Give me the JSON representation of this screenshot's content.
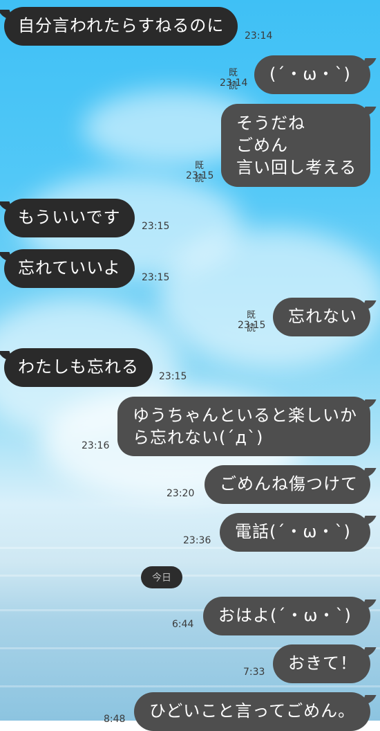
{
  "messages": [
    {
      "side": "in",
      "lines": [
        "自分言われたらすねるのに"
      ],
      "time": "23:14"
    },
    {
      "side": "out",
      "lines": [
        "(´・ω・`)"
      ],
      "time": "23:14",
      "read": "既読"
    },
    {
      "side": "out",
      "lines": [
        "そうだね",
        "ごめん",
        "言い回し考える"
      ],
      "time": "23:15",
      "read": "既読"
    },
    {
      "side": "in",
      "lines": [
        "もういいです"
      ],
      "time": "23:15"
    },
    {
      "side": "in",
      "lines": [
        "忘れていいよ"
      ],
      "time": "23:15"
    },
    {
      "side": "out",
      "lines": [
        "忘れない"
      ],
      "time": "23:15",
      "read": "既読"
    },
    {
      "side": "in",
      "lines": [
        "わたしも忘れる"
      ],
      "time": "23:15"
    },
    {
      "side": "out",
      "lines": [
        "ゆうちゃんといると楽しいか",
        "ら忘れない(´д`)"
      ],
      "time": "23:16"
    },
    {
      "side": "out",
      "lines": [
        "ごめんね傷つけて"
      ],
      "time": "23:20"
    },
    {
      "side": "out",
      "lines": [
        "電話(´・ω・`)"
      ],
      "time": "23:36"
    },
    {
      "side": "out",
      "lines": [
        "おはよ(´・ω・`)"
      ],
      "time": "6:44"
    },
    {
      "side": "out",
      "lines": [
        "おきて！"
      ],
      "time": "7:33"
    },
    {
      "side": "out",
      "lines": [
        "ひどいこと言ってごめん。"
      ],
      "time": "8:48"
    }
  ],
  "day_divider": "今日",
  "colors": {
    "incoming_bubble": "#2a2a2a",
    "outgoing_bubble": "#4e4e4e",
    "text": "#ffffff"
  }
}
